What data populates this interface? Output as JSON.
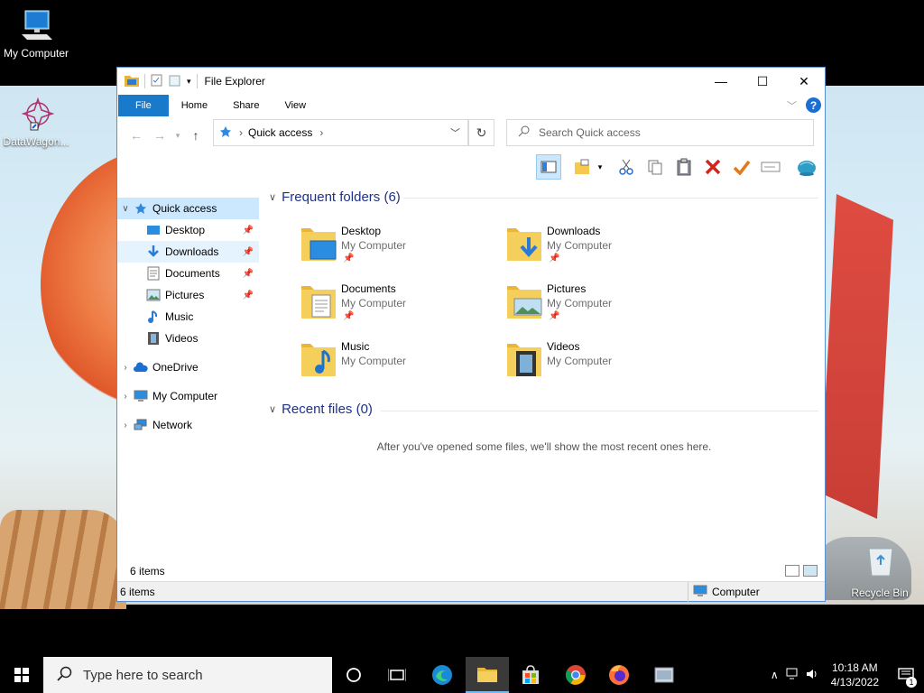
{
  "desktop": {
    "icons": [
      {
        "label": "My Computer"
      },
      {
        "label": "DataWagon..."
      },
      {
        "label": "Recycle Bin"
      }
    ]
  },
  "window": {
    "title": "File Explorer",
    "controls": {
      "minimize": "—",
      "maximize": "☐",
      "close": "✕"
    },
    "ribbon_tabs": [
      "File",
      "Home",
      "Share",
      "View"
    ],
    "help": "?",
    "address": {
      "crumb": "Quick access"
    },
    "search": {
      "placeholder": "Search Quick access"
    },
    "nav": {
      "quick_access": "Quick access",
      "items": [
        {
          "label": "Desktop",
          "pinned": true
        },
        {
          "label": "Downloads",
          "pinned": true
        },
        {
          "label": "Documents",
          "pinned": true
        },
        {
          "label": "Pictures",
          "pinned": true
        },
        {
          "label": "Music",
          "pinned": false
        },
        {
          "label": "Videos",
          "pinned": false
        }
      ],
      "onedrive": "OneDrive",
      "my_computer": "My Computer",
      "network": "Network"
    },
    "main": {
      "frequent_header": "Frequent folders (6)",
      "folders": [
        {
          "name": "Desktop",
          "location": "My Computer"
        },
        {
          "name": "Downloads",
          "location": "My Computer"
        },
        {
          "name": "Documents",
          "location": "My Computer"
        },
        {
          "name": "Pictures",
          "location": "My Computer"
        },
        {
          "name": "Music",
          "location": "My Computer"
        },
        {
          "name": "Videos",
          "location": "My Computer"
        }
      ],
      "recent_header": "Recent files (0)",
      "recent_empty": "After you've opened some files, we'll show the most recent ones here."
    },
    "status": {
      "count": "6 items"
    },
    "bottombar": {
      "count": "6 items",
      "location": "Computer"
    }
  },
  "taskbar": {
    "search_placeholder": "Type here to search",
    "time": "10:18 AM",
    "date": "4/13/2022",
    "notifications": "1"
  },
  "colors": {
    "accent": "#1979ca",
    "selection": "#cce8ff",
    "folder": "#f4c94e",
    "header_text": "#1e3287"
  }
}
